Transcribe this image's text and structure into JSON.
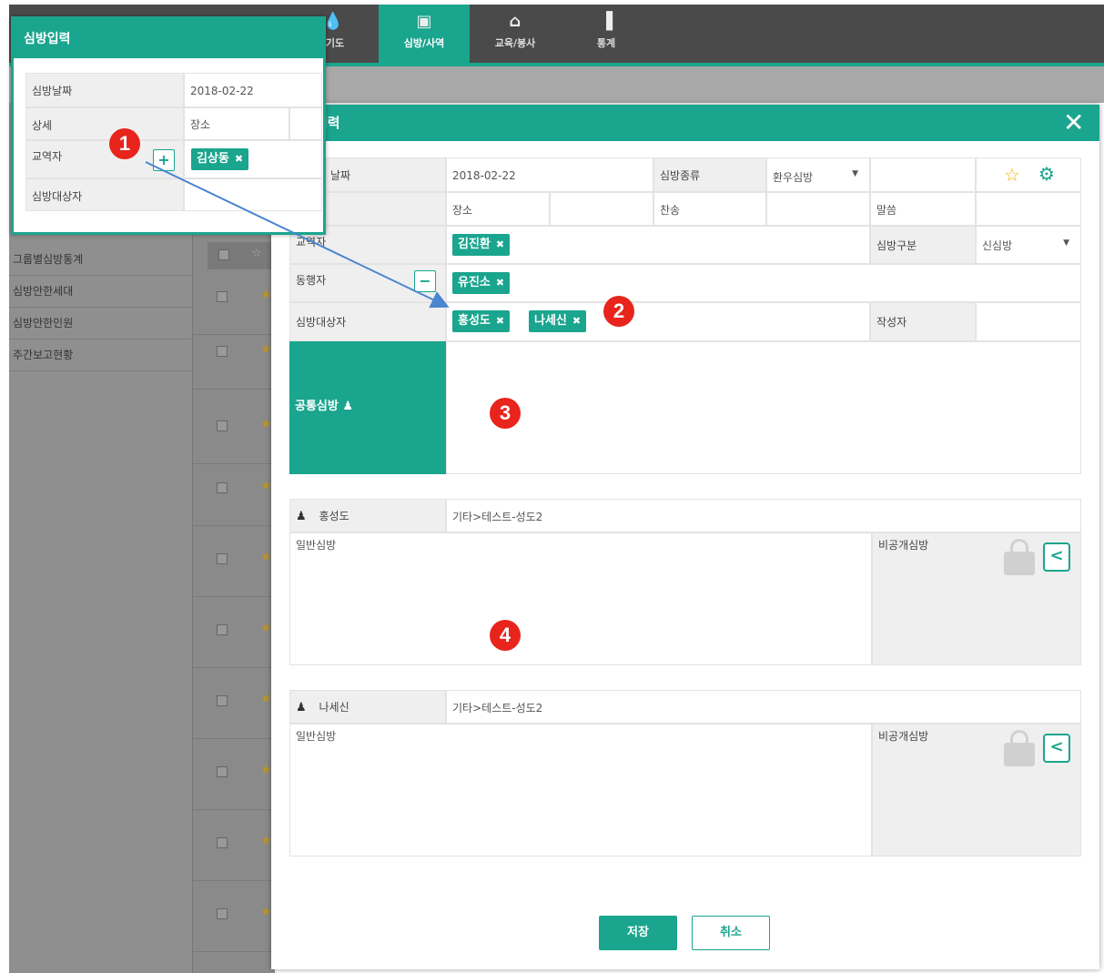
{
  "nav": {
    "tabs": [
      {
        "label": "/기도",
        "icon": "drop-icon"
      },
      {
        "label": "심방/사역",
        "icon": "briefcase-icon"
      },
      {
        "label": "교육/봉사",
        "icon": "graduation-cap-icon"
      },
      {
        "label": "통계",
        "icon": "bar-chart-icon"
      }
    ]
  },
  "sidebar": {
    "items": [
      "그룹별심방통계",
      "심방안한세대",
      "심방안한인원",
      "주간보고현황"
    ]
  },
  "popup": {
    "title": "심방입력",
    "rows": {
      "date_label": "심방날짜",
      "date_value": "2018-02-22",
      "detail_label": "상세",
      "place_label": "장소",
      "officer_label": "교역자",
      "officer_tag": "김상동",
      "target_label": "심방대상자"
    }
  },
  "modal": {
    "title": "입력",
    "form": {
      "date_label": "날짜",
      "date_value": "2018-02-22",
      "type_label": "심방종류",
      "type_value": "환우심방",
      "place_label": "장소",
      "hymn_label": "찬송",
      "word_label": "말씀",
      "officer_label": "교역자",
      "officer_tag": "김진환",
      "category_label": "심방구분",
      "category_value": "신심방",
      "companion_label": "동행자",
      "companion_tag": "유진소",
      "target_label": "심방대상자",
      "target_tags": [
        "홍성도",
        "나세신"
      ],
      "writer_label": "작성자",
      "common_label": "공통심방"
    },
    "persons": [
      {
        "name": "홍성도",
        "group": "기타>테스트-성도2",
        "general_label": "일반심방",
        "private_label": "비공개심방"
      },
      {
        "name": "나세신",
        "group": "기타>테스트-성도2",
        "general_label": "일반심방",
        "private_label": "비공개심방"
      }
    ],
    "buttons": {
      "save": "저장",
      "cancel": "취소"
    }
  },
  "badges": [
    "1",
    "2",
    "3",
    "4"
  ],
  "colors": {
    "accent": "#1aa58e",
    "badge": "#e8241c",
    "star": "#f0b400"
  }
}
